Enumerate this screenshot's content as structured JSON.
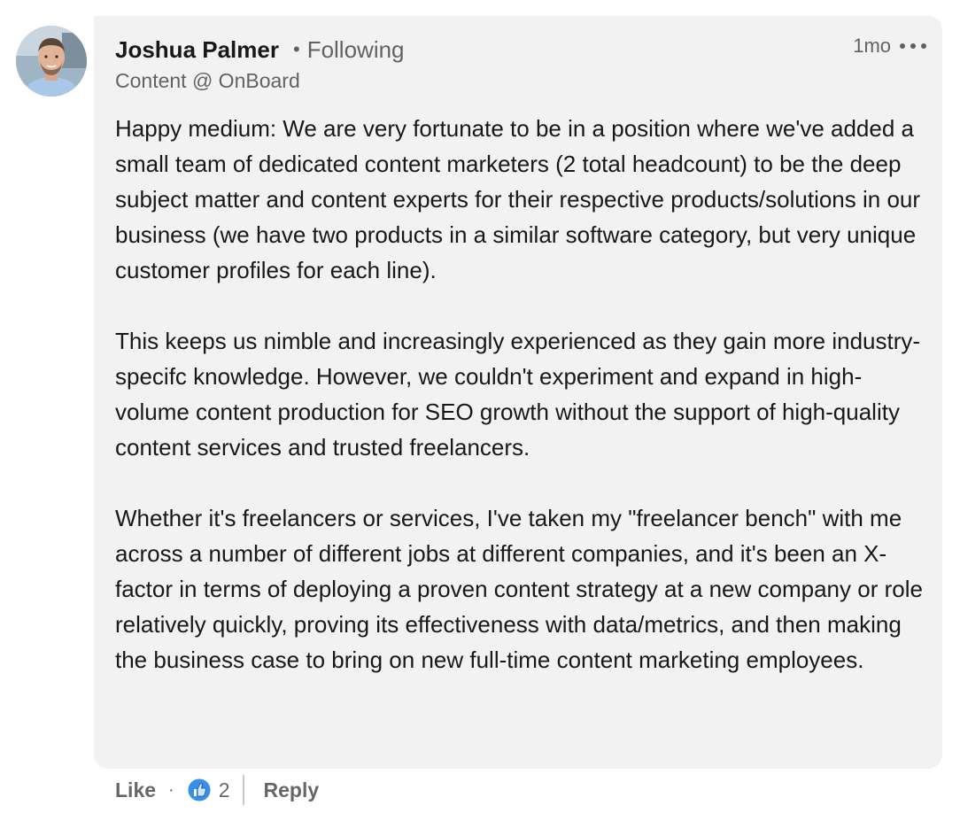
{
  "comment": {
    "author": {
      "name": "Joshua Palmer",
      "separator": "•",
      "follow_status": "Following",
      "headline": "Content @ OnBoard",
      "avatar_icon": "profile-photo"
    },
    "timestamp": "1mo",
    "more_icon": "more-horizontal-icon",
    "paragraphs": [
      "Happy medium: We are very fortunate to be in a position where we've added a small team of dedicated content marketers (2 total headcount) to be the deep subject matter and content experts for their respective products/solutions in our business (we have two products in a similar software category, but very unique customer profiles for each line).",
      "This keeps us nimble and increasingly experienced as they gain more industry-specifc knowledge. However, we couldn't experiment and expand in high-volume content production for SEO growth without the support of high-quality content services and trusted freelancers.",
      "Whether it's freelancers or services, I've taken my \"freelancer bench\" with me across a number of different jobs at different companies, and it's been an X-factor in terms of deploying a proven content strategy at a new company or role relatively quickly, proving its effectiveness with data/metrics, and then making the business case to bring on new full-time content marketing employees."
    ]
  },
  "actions": {
    "like_label": "Like",
    "dot": "·",
    "reaction_icon": "like-reaction-icon",
    "reaction_count": "2",
    "reply_label": "Reply"
  },
  "colors": {
    "bubble_bg": "#f2f2f2",
    "like_blue": "#378fe9",
    "text_primary": "#1a1a1a",
    "text_secondary": "#666666"
  }
}
